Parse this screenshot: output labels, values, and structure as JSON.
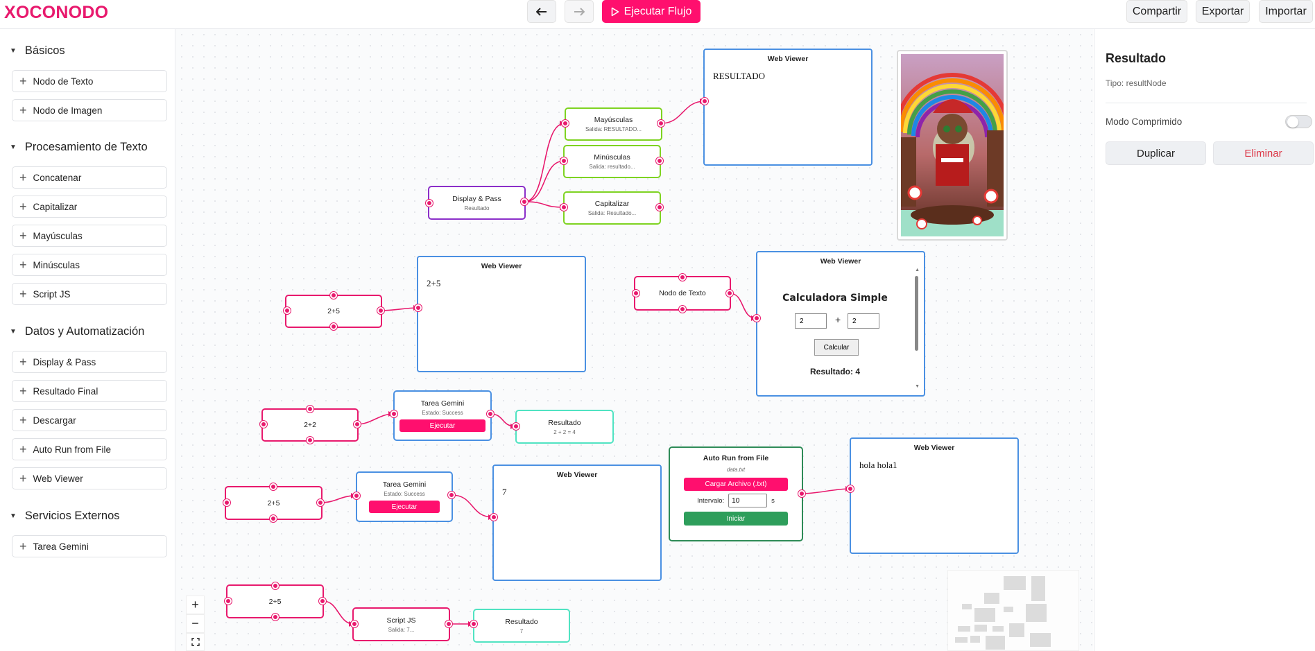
{
  "header": {
    "logo": "XOCONODO",
    "undo_icon": "arrow-left-icon",
    "redo_icon": "arrow-right-icon",
    "run_label": "Ejecutar Flujo",
    "share_label": "Compartir",
    "export_label": "Exportar",
    "import_label": "Importar"
  },
  "sidebar": {
    "sections": [
      {
        "title": "Básicos",
        "items": [
          "Nodo de Texto",
          "Nodo de Imagen"
        ]
      },
      {
        "title": "Procesamiento de Texto",
        "items": [
          "Concatenar",
          "Capitalizar",
          "Mayúsculas",
          "Minúsculas",
          "Script JS"
        ]
      },
      {
        "title": "Datos y Automatización",
        "items": [
          "Display & Pass",
          "Resultado Final",
          "Descargar",
          "Auto Run from File",
          "Web Viewer"
        ]
      },
      {
        "title": "Servicios Externos",
        "items": [
          "Tarea Gemini"
        ]
      }
    ]
  },
  "canvas": {
    "nodes": {
      "display_pass": {
        "title": "Display & Pass",
        "sub": "Resultado"
      },
      "mayusculas": {
        "title": "Mayúsculas",
        "sub": "Salida: RESULTADO..."
      },
      "minusculas": {
        "title": "Minúsculas",
        "sub": "Salida: resultado..."
      },
      "capitalizar": {
        "title": "Capitalizar",
        "sub": "Salida: Resultado..."
      },
      "wv1": {
        "title": "Web Viewer",
        "body": "RESULTADO"
      },
      "text_a": {
        "title": "2+5"
      },
      "wv2": {
        "title": "Web Viewer",
        "body": "2+5"
      },
      "nodo_texto": {
        "title": "Nodo de Texto"
      },
      "wv_calc": {
        "title": "Web Viewer",
        "calc_title": "Calculadora Simple",
        "in1": "2",
        "plus": "+",
        "in2": "2",
        "button": "Calcular",
        "result": "Resultado: 4"
      },
      "text_b": {
        "title": "2+2"
      },
      "gemini1": {
        "title": "Tarea Gemini",
        "sub": "Estado: Success",
        "button": "Ejecutar"
      },
      "resultado1": {
        "title": "Resultado",
        "sub": "2 + 2 = 4"
      },
      "text_c": {
        "title": "2+5"
      },
      "gemini2": {
        "title": "Tarea Gemini",
        "sub": "Estado: Success",
        "button": "Ejecutar"
      },
      "wv3": {
        "title": "Web Viewer",
        "body": "7"
      },
      "autorun": {
        "title": "Auto Run from File",
        "file": "data.txt",
        "load_button": "Cargar Archivo (.txt)",
        "interval_label": "Intervalo:",
        "interval_value": "10",
        "interval_unit": "s",
        "start_button": "Iniciar"
      },
      "wv4": {
        "title": "Web Viewer",
        "body": "hola hola1"
      },
      "text_d": {
        "title": "2+5"
      },
      "scriptjs": {
        "title": "Script JS",
        "sub": "Salida: 7..."
      },
      "resultado2": {
        "title": "Resultado",
        "sub": "7"
      }
    },
    "zoom": {
      "in": "+",
      "out": "−",
      "fit_icon": "fit-view-icon"
    }
  },
  "panel": {
    "title": "Resultado",
    "type_label": "Tipo: resultNode",
    "compressed_label": "Modo Comprimido",
    "compressed_on": false,
    "duplicate_label": "Duplicar",
    "delete_label": "Eliminar"
  },
  "colors": {
    "accent": "#ff0f6e",
    "edge": "#e8196d",
    "purple": "#8b2fc9",
    "green": "#7ed321",
    "blue": "#4a90e2",
    "teal": "#50e3c2",
    "start": "#2e8b57",
    "delete": "#dc3545"
  }
}
